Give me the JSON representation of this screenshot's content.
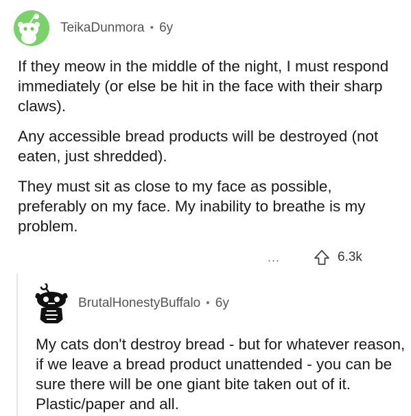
{
  "comment1": {
    "username": "TeikaDunmora",
    "separator": "•",
    "age": "6y",
    "paragraphs": [
      "If they meow in the middle of the night, I must respond immediately (or else be hit in the face with their sharp claws).",
      "Any accessible bread products will be destroyed (not eaten, just shredded).",
      "They must sit as close to my face as possible, preferably on my face. My inability to breathe is my problem."
    ],
    "more_label": "...",
    "score": "6.3k"
  },
  "comment2": {
    "username": "BrutalHonestyBuffalo",
    "separator": "•",
    "age": "6y",
    "paragraphs": [
      "My cats don't destroy bread - but for whatever reason, if we leave a bread product unattended - you can be sure there will be one giant bite taken out of it. Plastic/paper and all."
    ]
  },
  "colors": {
    "avatar1_bg": "#7ad26a",
    "text": "#1a1a1b",
    "meta": "#555555",
    "thread_line": "#e6e6e6"
  },
  "icons": {
    "avatar1": "snoo-avatar-green",
    "avatar2": "snoo-avatar-skull",
    "upvote": "upvote-arrow-icon",
    "more": "more-options-icon"
  }
}
